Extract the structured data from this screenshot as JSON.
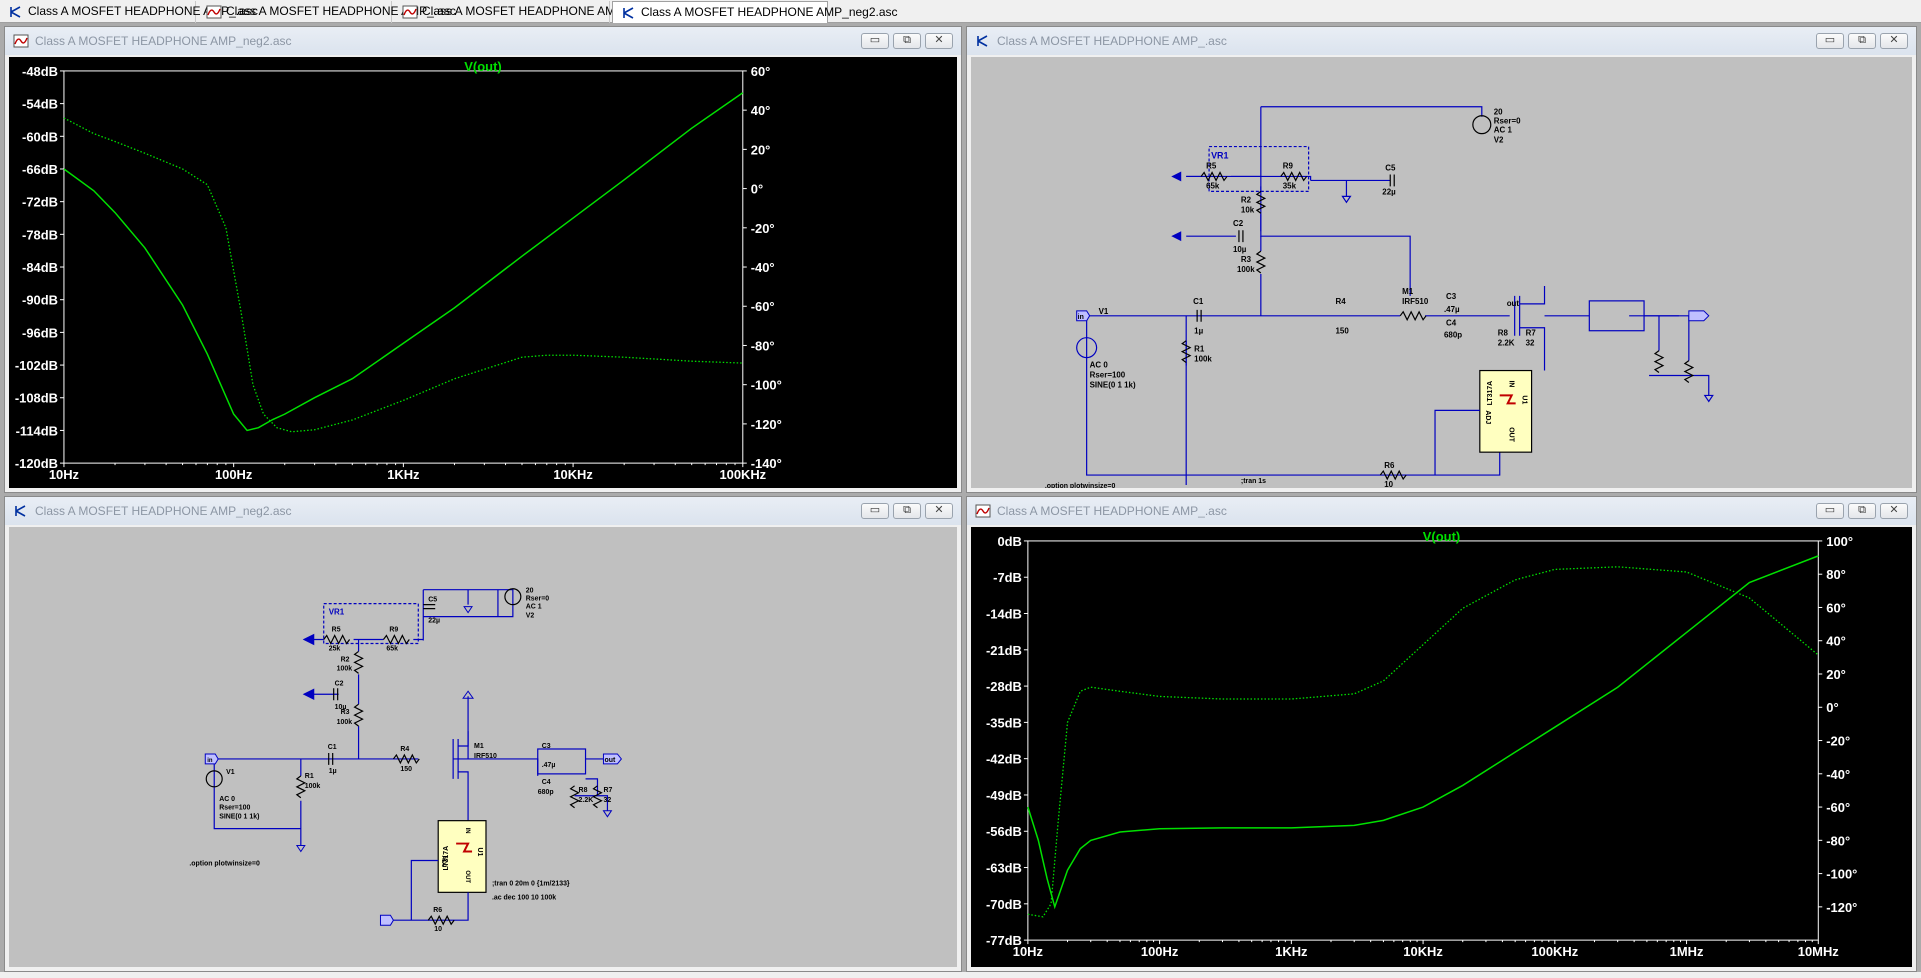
{
  "tabs": [
    {
      "label": "Class A MOSFET HEADPHONE AMP_.asc",
      "icon": "schematic-icon"
    },
    {
      "label": "Class A MOSFET HEADPHONE AMP_.asc",
      "icon": "waveform-icon"
    },
    {
      "label": "Class A MOSFET HEADPHONE AMP_neg2.asc",
      "icon": "waveform-icon"
    },
    {
      "label": "Class A MOSFET HEADPHONE AMP_neg2.asc",
      "icon": "schematic-icon"
    }
  ],
  "windows": {
    "tl": {
      "title": "Class A MOSFET HEADPHONE AMP_neg2.asc"
    },
    "tr": {
      "title": "Class A MOSFET HEADPHONE AMP_.asc"
    },
    "bl": {
      "title": "Class A MOSFET HEADPHONE AMP_neg2.asc"
    },
    "br": {
      "title": "Class A MOSFET HEADPHONE AMP_.asc"
    }
  },
  "window_buttons": {
    "minimize": "▭",
    "restore": "⧉",
    "close": "✕"
  },
  "colors": {
    "trace": "#00e000",
    "plot_bg": "#000000",
    "schematic_bg": "#c0c0c0",
    "wire": "#0000c0"
  },
  "chart_data": [
    {
      "type": "line",
      "title": "V(out)",
      "x_scale": "log",
      "xlim": [
        10,
        100000
      ],
      "x_ticks": [
        "10Hz",
        "100Hz",
        "1KHz",
        "10KHz",
        "100KHz"
      ],
      "ylim": [
        -120,
        -48
      ],
      "y_ticks": [
        "-48dB",
        "-54dB",
        "-60dB",
        "-66dB",
        "-72dB",
        "-78dB",
        "-84dB",
        "-90dB",
        "-96dB",
        "-102dB",
        "-108dB",
        "-114dB",
        "-120dB"
      ],
      "y2lim": [
        -140,
        60
      ],
      "y2_ticks": [
        "60°",
        "40°",
        "20°",
        "0°",
        "-20°",
        "-40°",
        "-60°",
        "-80°",
        "-100°",
        "-120°",
        "-140°"
      ],
      "series": [
        {
          "style": "solid",
          "axis": "left",
          "x": [
            10,
            15,
            20,
            30,
            50,
            70,
            100,
            120,
            140,
            170,
            200,
            300,
            500,
            1000,
            2000,
            5000,
            10000,
            20000,
            50000,
            100000
          ],
          "y": [
            -66,
            -70,
            -74,
            -80.5,
            -91,
            -100,
            -111,
            -114,
            -113.5,
            -112,
            -111,
            -108,
            -104.5,
            -98,
            -91.5,
            -82,
            -75,
            -68,
            -58.5,
            -52
          ]
        },
        {
          "style": "dotted",
          "axis": "right",
          "x": [
            10,
            15,
            20,
            30,
            50,
            70,
            90,
            110,
            130,
            150,
            180,
            220,
            300,
            500,
            1000,
            2000,
            5000,
            7000,
            10000,
            20000,
            50000,
            100000
          ],
          "y": [
            36,
            28,
            24,
            18,
            10,
            2,
            -20,
            -62,
            -100,
            -115,
            -122,
            -124,
            -123,
            -118,
            -108,
            -97,
            -86,
            -85,
            -85,
            -86,
            -88,
            -89
          ]
        }
      ]
    },
    {
      "type": "line",
      "title": "V(out)",
      "x_scale": "log",
      "xlim": [
        10,
        10000000
      ],
      "x_ticks": [
        "10Hz",
        "100Hz",
        "1KHz",
        "10KHz",
        "100KHz",
        "1MHz",
        "10MHz"
      ],
      "ylim": [
        -77,
        0
      ],
      "y_ticks": [
        "0dB",
        "-7dB",
        "-14dB",
        "-21dB",
        "-28dB",
        "-35dB",
        "-42dB",
        "-49dB",
        "-56dB",
        "-63dB",
        "-70dB",
        "-77dB"
      ],
      "y2lim": [
        -140,
        100
      ],
      "y2_ticks": [
        "100°",
        "80°",
        "60°",
        "40°",
        "20°",
        "0°",
        "-20°",
        "-40°",
        "-60°",
        "-80°",
        "-100°",
        "-120°"
      ],
      "series": [
        {
          "style": "dotted",
          "axis": "left",
          "x": [
            10,
            13,
            15,
            17,
            20,
            25,
            30,
            50,
            100,
            300,
            1000,
            3000,
            5000,
            10000,
            20000,
            50000,
            100000,
            300000,
            1000000,
            3000000,
            10000000
          ],
          "y": [
            -72,
            -72.5,
            -70,
            -54,
            -35,
            -29,
            -28.2,
            -29,
            -30,
            -30.5,
            -30.5,
            -29.5,
            -27,
            -20,
            -13,
            -7.5,
            -5.5,
            -5,
            -6,
            -11,
            -22
          ]
        },
        {
          "style": "solid",
          "axis": "right",
          "x": [
            10,
            12,
            14,
            16,
            20,
            25,
            30,
            50,
            100,
            300,
            1000,
            3000,
            5000,
            10000,
            20000,
            50000,
            100000,
            300000,
            1000000,
            3000000,
            10000000
          ],
          "y": [
            -60,
            -80,
            -103,
            -120,
            -98,
            -85,
            -80,
            -75,
            -73,
            -72.5,
            -72.5,
            -71,
            -68,
            -60,
            -47,
            -27,
            -12,
            12,
            45,
            75,
            91
          ]
        }
      ]
    }
  ],
  "schematic": {
    "labels": {
      "vr1": "VR1",
      "r5": "R5",
      "r5v_a": "65k",
      "r5v_b": "25k",
      "r9": "R9",
      "r9v_a": "35k",
      "r9v_b": "65k",
      "c5": "C5",
      "c5v": "22µ",
      "v2": "V2",
      "v2v": "20",
      "rser": "Rser=0",
      "ac1": "AC 1",
      "r2": "R2",
      "r2v_a": "10k",
      "r2v_b": "100k",
      "c2": "C2",
      "c2v": "10µ",
      "r3": "R3",
      "r3v": "100k",
      "c1": "C1",
      "c1v": "1µ",
      "r4": "R4",
      "r4v": "150",
      "m1": "M1",
      "m1v": "IRF510",
      "c3": "C3",
      "c3v": ".47µ",
      "c4": "C4",
      "c4v": "680p",
      "out": "out",
      "r8": "R8",
      "r8v": "2.2K",
      "r7": "R7",
      "r7v": "32",
      "v1": "V1",
      "r1": "R1",
      "r1v": "100k",
      "ac0": "AC 0",
      "rser100": "Rser=100",
      "sine": "SINE(0 1 1k)",
      "u1": "U1",
      "lt317a": "LT317A",
      "in": "IN",
      "adj": "ADJ",
      "outpin": "OUT",
      "r6": "R6",
      "r6v": "10",
      "in_label": "in",
      "plotwin": ".option plotwinsize=0",
      "tran_short": ";tran 1s",
      "tran_long": ";tran 0 20m 0 {1m/2133}",
      "acdec": ".ac dec 100 10 100k"
    }
  }
}
